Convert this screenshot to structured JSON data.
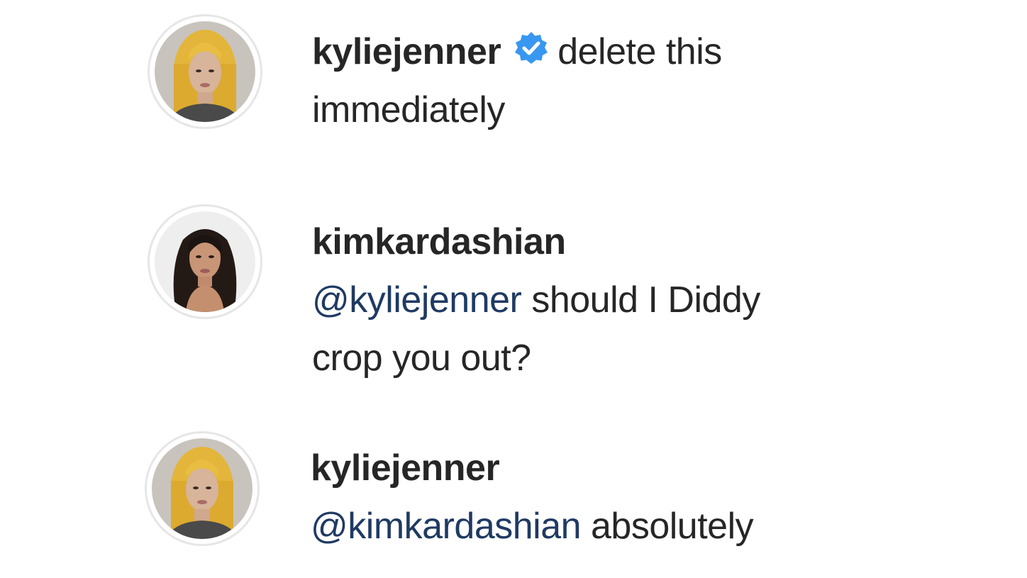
{
  "comments": [
    {
      "username": "kyliejenner",
      "verified": true,
      "verified_icon": "verified-badge-icon",
      "mention": "",
      "line1": "delete this",
      "line2": "immediately",
      "avatar_icon": "kylie-avatar"
    },
    {
      "username": "kimkardashian",
      "verified": false,
      "mention": "@kyliejenner",
      "line1": " should I Diddy",
      "line2": "crop you out?",
      "avatar_icon": "kim-avatar"
    },
    {
      "username": "kyliejenner",
      "verified": false,
      "mention": "@kimkardashian",
      "line1": " absolutely",
      "line2": "",
      "avatar_icon": "kylie-avatar"
    }
  ],
  "colors": {
    "verified_blue": "#3897f0",
    "mention_blue": "#1f3a63",
    "text": "#262626",
    "avatar_ring": "#e6e6e6"
  }
}
